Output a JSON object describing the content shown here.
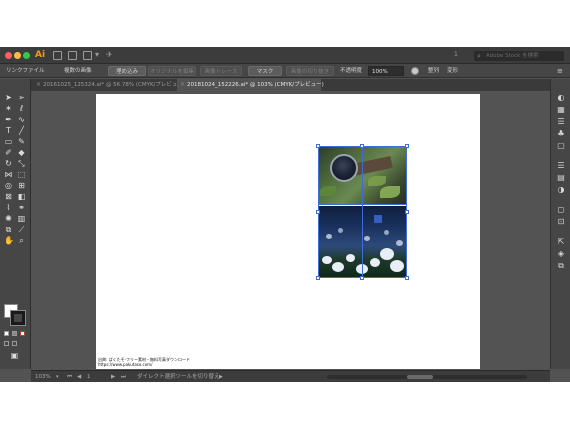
{
  "app": {
    "logo": "Ai",
    "workspace_count": "1",
    "search_placeholder": "Adobe Stock を検索"
  },
  "control_bar": {
    "link_file": "リンクファイル",
    "multiple_images": "複数の画像",
    "embed": "埋め込み",
    "edit_original": "オリジナルを編集",
    "image_trace": "画像トレース",
    "mask": "マスク",
    "crop_image": "画像の切り抜き",
    "opacity_label": "不透明度",
    "opacity_value": "100%",
    "align": "整列",
    "transform": "変形"
  },
  "tabs": [
    {
      "label": "20161025_125324.ai* @ 56.78% (CMYK/プレビュー)",
      "active": false
    },
    {
      "label": "20181024_152226.ai* @ 103% (CMYK/プレビュー)",
      "active": true
    }
  ],
  "tools": {
    "icons": [
      "selection-tool-icon",
      "direct-selection-tool-icon",
      "magic-wand-icon",
      "lasso-icon",
      "pen-icon",
      "curvature-icon",
      "type-icon",
      "line-icon",
      "rectangle-icon",
      "paintbrush-icon",
      "shaper-icon",
      "eraser-icon",
      "rotate-icon",
      "scale-icon",
      "width-icon",
      "free-transform-icon",
      "shape-builder-icon",
      "perspective-icon",
      "mesh-icon",
      "gradient-icon",
      "eyedropper-icon",
      "blend-icon",
      "symbol-sprayer-icon",
      "graph-icon",
      "artboard-icon",
      "slice-icon",
      "hand-icon",
      "zoom-icon"
    ]
  },
  "canvas": {
    "credit_line1": "出典: ぱくたそ-フリー素材・無料写真ダウンロード",
    "credit_line2": "https://www.pakutaso.com/"
  },
  "status_bar": {
    "zoom": "103%",
    "artboard_number": "1",
    "tool_hint": "ダイレクト選択ツールを切り替え"
  },
  "colors": {
    "accent": "#3f6cd6",
    "chrome": "#535353",
    "panel": "#464646",
    "logo": "#ff9a00"
  }
}
